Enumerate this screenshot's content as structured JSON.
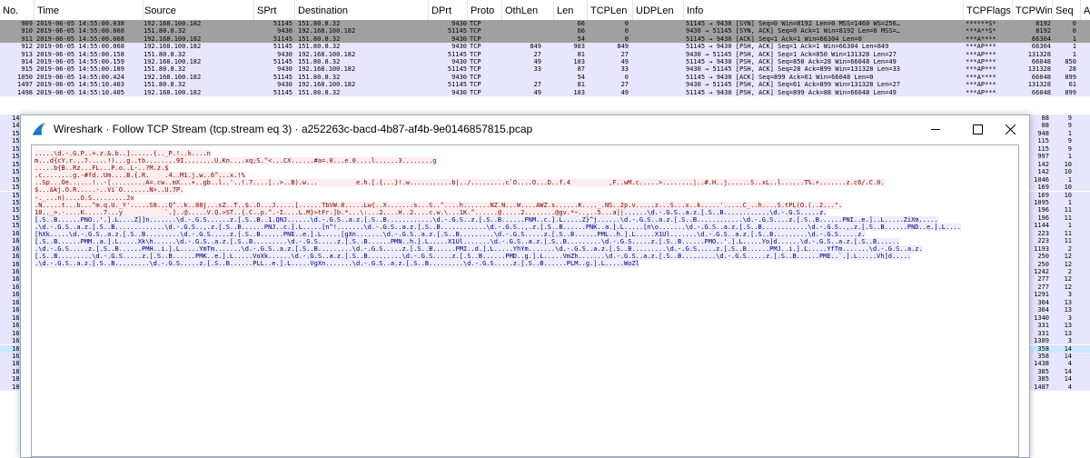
{
  "packet_list": {
    "columns": [
      "No.",
      "Time",
      "Source",
      "SPrt",
      "Destination",
      "DPrt",
      "Proto",
      "OthLen",
      "Len",
      "TCPLen",
      "UDPLen",
      "Info",
      "TCPFlags",
      "TCPWin",
      "Seq",
      "Ack"
    ],
    "rows": [
      {
        "no": "909",
        "time": "2019-06-05 14:55:00.038",
        "src": "192.168.100.182",
        "sprt": "51145",
        "dst": "151.80.8.32",
        "dprt": "9430",
        "proto": "TCP",
        "othlen": "",
        "len": "66",
        "tcplen": "0",
        "info": "51145 → 9430 [SYN] Seq=0 Win=8192 Len=0 MSS=1460 WS=256…",
        "flags": "******S*",
        "win": "8192",
        "seq": "0",
        "style": "gray"
      },
      {
        "no": "910",
        "time": "2019-06-05 14:55:00.068",
        "src": "151.80.8.32",
        "sprt": "9430",
        "dst": "192.168.100.182",
        "dprt": "51145",
        "proto": "TCP",
        "othlen": "",
        "len": "66",
        "tcplen": "0",
        "info": "9430 → 51145 [SYN, ACK] Seq=0 Ack=1 Win=8192 Len=0 MSS=…",
        "flags": "***A**S*",
        "win": "8192",
        "seq": "0",
        "style": "gray"
      },
      {
        "no": "911",
        "time": "2019-06-05 14:55:00.068",
        "src": "192.168.100.182",
        "sprt": "51145",
        "dst": "151.80.8.32",
        "dprt": "9430",
        "proto": "TCP",
        "othlen": "",
        "len": "54",
        "tcplen": "0",
        "info": "51145 → 9430 [ACK] Seq=1 Ack=1 Win=66304 Len=0",
        "flags": "***A****",
        "win": "66304",
        "seq": "1",
        "style": "gray"
      },
      {
        "no": "912",
        "time": "2019-06-05 14:55:00.068",
        "src": "192.168.100.182",
        "sprt": "51145",
        "dst": "151.80.8.32",
        "dprt": "9430",
        "proto": "TCP",
        "othlen": "849",
        "len": "903",
        "tcplen": "849",
        "info": "51145 → 9430 [PSH, ACK] Seq=1 Ack=1 Win=66304 Len=849",
        "flags": "***AP***",
        "win": "66304",
        "seq": "1",
        "style": "lav"
      },
      {
        "no": "913",
        "time": "2019-06-05 14:55:00.158",
        "src": "151.80.8.32",
        "sprt": "9430",
        "dst": "192.168.100.182",
        "dprt": "51145",
        "proto": "TCP",
        "othlen": "27",
        "len": "81",
        "tcplen": "27",
        "info": "9430 → 51145 [PSH, ACK] Seq=1 Ack=850 Win=131328 Len=27",
        "flags": "***AP***",
        "win": "131328",
        "seq": "1",
        "style": "lav"
      },
      {
        "no": "914",
        "time": "2019-06-05 14:55:00.159",
        "src": "192.168.100.182",
        "sprt": "51145",
        "dst": "151.80.8.32",
        "dprt": "9430",
        "proto": "TCP",
        "othlen": "49",
        "len": "103",
        "tcplen": "49",
        "info": "51145 → 9430 [PSH, ACK] Seq=850 Ack=28 Win=66048 Len=49",
        "flags": "***AP***",
        "win": "66048",
        "seq": "850",
        "style": "lav"
      },
      {
        "no": "915",
        "time": "2019-06-05 14:55:00.189",
        "src": "151.80.8.32",
        "sprt": "9430",
        "dst": "192.168.100.182",
        "dprt": "51145",
        "proto": "TCP",
        "othlen": "33",
        "len": "87",
        "tcplen": "33",
        "info": "9430 → 51145 [PSH, ACK] Seq=28 Ack=899 Win=131328 Len=33",
        "flags": "***AP***",
        "win": "131328",
        "seq": "28",
        "style": "lav"
      },
      {
        "no": "1050",
        "time": "2019-06-05 14:55:00.424",
        "src": "192.168.100.182",
        "sprt": "51145",
        "dst": "151.80.8.32",
        "dprt": "9430",
        "proto": "TCP",
        "othlen": "",
        "len": "54",
        "tcplen": "0",
        "info": "51145 → 9430 [ACK] Seq=899 Ack=61 Win=66048 Len=0",
        "flags": "***A****",
        "win": "66048",
        "seq": "899",
        "style": "lav"
      },
      {
        "no": "1497",
        "time": "2019-06-05 14:55:10.403",
        "src": "151.80.8.32",
        "sprt": "9430",
        "dst": "192.168.100.182",
        "dprt": "51145",
        "proto": "TCP",
        "othlen": "27",
        "len": "81",
        "tcplen": "27",
        "info": "9430 → 51145 [PSH, ACK] Seq=61 Ack=899 Win=131328 Len=27",
        "flags": "***AP***",
        "win": "131328",
        "seq": "61",
        "style": "lav"
      },
      {
        "no": "1498",
        "time": "2019-06-05 14:55:10.405",
        "src": "192.168.100.182",
        "sprt": "51145",
        "dst": "151.80.8.32",
        "dprt": "9430",
        "proto": "TCP",
        "othlen": "49",
        "len": "103",
        "tcplen": "49",
        "info": "51145 → 9430 [PSH, ACK] Seq=899 Ack=88 Win=66048 Len=49",
        "flags": "***AP***",
        "win": "66048",
        "seq": "899",
        "style": "lav"
      }
    ],
    "side_rows": [
      {
        "n": "14",
        "win": "88",
        "seq": "9"
      },
      {
        "n": "14",
        "win": "88",
        "seq": "9"
      },
      {
        "n": "15",
        "win": "948",
        "seq": "1"
      },
      {
        "n": "15",
        "win": "115",
        "seq": "9"
      },
      {
        "n": "15",
        "win": "115",
        "seq": "9"
      },
      {
        "n": "15",
        "win": "997",
        "seq": "1"
      },
      {
        "n": "15",
        "win": "142",
        "seq": "10"
      },
      {
        "n": "15",
        "win": "142",
        "seq": "10"
      },
      {
        "n": "15",
        "win": "1046",
        "seq": "1"
      },
      {
        "n": "15",
        "win": "169",
        "seq": "10"
      },
      {
        "n": "15",
        "win": "169",
        "seq": "10"
      },
      {
        "n": "15",
        "win": "1095",
        "seq": "1"
      },
      {
        "n": "15",
        "win": "196",
        "seq": "11"
      },
      {
        "n": "15",
        "win": "196",
        "seq": "11"
      },
      {
        "n": "15",
        "win": "1144",
        "seq": "1"
      },
      {
        "n": "16",
        "win": "223",
        "seq": "11"
      },
      {
        "n": "16",
        "win": "223",
        "seq": "11"
      },
      {
        "n": "16",
        "win": "1193",
        "seq": "2"
      },
      {
        "n": "16",
        "win": "250",
        "seq": "12"
      },
      {
        "n": "16",
        "win": "250",
        "seq": "12"
      },
      {
        "n": "16",
        "win": "1242",
        "seq": "2"
      },
      {
        "n": "16",
        "win": "277",
        "seq": "12"
      },
      {
        "n": "16",
        "win": "277",
        "seq": "12"
      },
      {
        "n": "16",
        "win": "1291",
        "seq": "3"
      },
      {
        "n": "16",
        "win": "304",
        "seq": "13"
      },
      {
        "n": "16",
        "win": "304",
        "seq": "13"
      },
      {
        "n": "16",
        "win": "1340",
        "seq": "3"
      },
      {
        "n": "16",
        "win": "331",
        "seq": "13"
      },
      {
        "n": "16",
        "win": "331",
        "seq": "13"
      },
      {
        "n": "16",
        "win": "1389",
        "seq": "3"
      },
      {
        "n": "16",
        "win": "358",
        "seq": "14"
      },
      {
        "n": "16",
        "win": "358",
        "seq": "14"
      },
      {
        "n": "18",
        "win": "1438",
        "seq": "4"
      },
      {
        "n": "18",
        "win": "385",
        "seq": "14"
      },
      {
        "n": "18",
        "win": "385",
        "seq": "14"
      },
      {
        "n": "18",
        "win": "1487",
        "seq": "4"
      }
    ]
  },
  "dialog": {
    "title": "Wireshark · Follow TCP Stream (tcp.stream eq 3) · a252263c-bacd-4b87-af4b-9e0146857815.pcap",
    "stream_lines": [
      [
        {
          "d": "c",
          "t": ".....\\d.-.G.P..+.z.&.b..]......{.._P.!..k....n"
        }
      ],
      [
        {
          "d": "c",
          "t": "m...d{cY.r...7.....!)...g..tb........9I........U.Kn....xq;S.^<...CX......#a=.0...e.0....l......3........g"
        }
      ],
      [
        {
          "d": "c",
          "t": ".....b{B..Rz...FL...P.o..L-..?M.z.$"
        }
      ],
      [
        {
          "d": "c",
          "t": ".c........g.-#fd..Um....B.{.R.    .4..M1.j.w..6^...x.!%"
        }
      ],
      [
        {
          "d": "c",
          "t": "..Sp...Oe......!..-[.........A=.cw..mX...+..gb..l..'..!.7....[..>..B).w...          e.h.[.{...}!.w...........b|../.........c`O....O...D..f.4          ,F..wM.c.....>........|..#.H..j......S..xL..l......T%.+.......z.c6/.C.0."
        }
      ],
      [
        {
          "d": "c",
          "t": "$...&kj.O.R.....-..Vi`O.......N>..U.7P."
        }
      ],
      [
        {
          "d": "c",
          "t": "-._...n)....O.S.........Jx"
        }
      ],
      [
        {
          "d": "c",
          "t": ".N.....t...b...^m.q.U._Y'.....S8...Q^..k..88j...sZ..T..$..O...J.....[......TbVW.8.....Lw{..X.......s...S..^....h.......NZ.N...W....AWZ.s......K...._.NS..2p.v.....z...S...x..k.....'.....C_..h....S.tPL(O.(..2...\"."
        }
      ],
      [
        {
          "d": "c",
          "t": "18.._>.-....K.....7...y           `.]..@.....V.Q.>ST..{.C..p.^.-I....L.M}>tFr.]b.*...\\:...2....H..2....c.w.\\...1K.^......@.....2........@gv.*~..,..5...a]|"
        },
        {
          "d": "s",
          "t": "......\\d.-.G.S..a.z.[.S..B............\\d.-.G.S.....z."
        }
      ],
      [
        {
          "d": "s",
          "t": "[.S..B......PNO..'.].L....Z]]n.......\\d.-.G.S......z.[.S..B..1.QNJ......\\d.-.G.S..a.z.[.S..B............\\d.-.G.S..z.[.S..B......PNM..c.].L.....Z}^j......\\d.-.G.S..a.z.[.S..B............\\d.-.G.S....z.[.S..B......PNI..e.]..L.....ZiXm....."
        }
      ],
      [
        {
          "d": "s",
          "t": ".\\d.-.G.S..a.z.[.S..B.............\\d.-.G.S..,.z.[.S..B......PNJ..c.].L.....[n^!.......\\d.-.G.S..a.z.[.S..B............\\d.-.G.S..,.z.[.S..B......PNK..a.].L.....[n\\o.......\\d.-.G.S..a.z.[.S..B............\\d.-.G.S..,.z.[.S..B......PND..e.].L...."
        }
      ],
      [
        {
          "d": "s",
          "t": "[hXk.....\\d.-.G.S..a.z.[.S..B.........\\d.-.G.S.....z.[.S..B......PNE..e.].L.....[gXn.......\\d.-.G.S..a.z.[.S..B.........\\d.-.G.S.....z.[.S..B......PML..h.].L.....X1Ul.......\\d.-.G.S..a.z.[.S..B.........\\d.-.G.S.....z."
        }
      ],
      [
        {
          "d": "s",
          "t": "[.S..B......PMM..a.].L.....Xk\\h......\\d.-.G.S..a.z.[.S..B.........\\d.-.G.S.....z.[.S..B......PMN..h.].L.....X1Ul.......\\d.-.G.S..a.z.[.S..B.........\\d.-.G.S.....z.[.S..B......PMO..'.].L.....Yo]d......\\d.-.G.S..a.z.[.S..B......"
        }
      ],
      [
        {
          "d": "s",
          "t": ".\\d.-.G.S.....z.[.S..B......PMH..i.].L.....YmTm.......\\d.-.G.S..a.z.[.S..B.........\\d.-.G.S.....z.[.S..B......PMI..d.].L.....YhYm.......\\d.-.G.S..a.z.[.S..B.........\\d.-.G.S.....z.[.S..B......PMJ..i.].L.....YfTm.......\\d.-.G.S..a.z."
        }
      ],
      [
        {
          "d": "s",
          "t": "[.S..B.........\\d.-.G.S.....z.[.S..B......PMK..e.].L.....VoXk......\\d.-.G.S..a.z.[.S..B.........\\d.-.G.S.....z.[.S..B......PMD..g.].L.....VmZh.......\\d.-.G.S..a.z.[.S..B.........\\d.-.G.S.....z.[.S..B......PME..`.].L.....Vh]d....."
        }
      ],
      [
        {
          "d": "s",
          "t": ".\\d.-.G.S..a.z.[.S..B.........\\d.-.G.S.....z.[.S..B......PLL..e.].L.....VgXn.......\\d.-.G.S..a.z.[.S..B.........\\d.-.G.S.....z.[.S..B......PLM..g.].L.....WoZl"
        }
      ]
    ]
  }
}
